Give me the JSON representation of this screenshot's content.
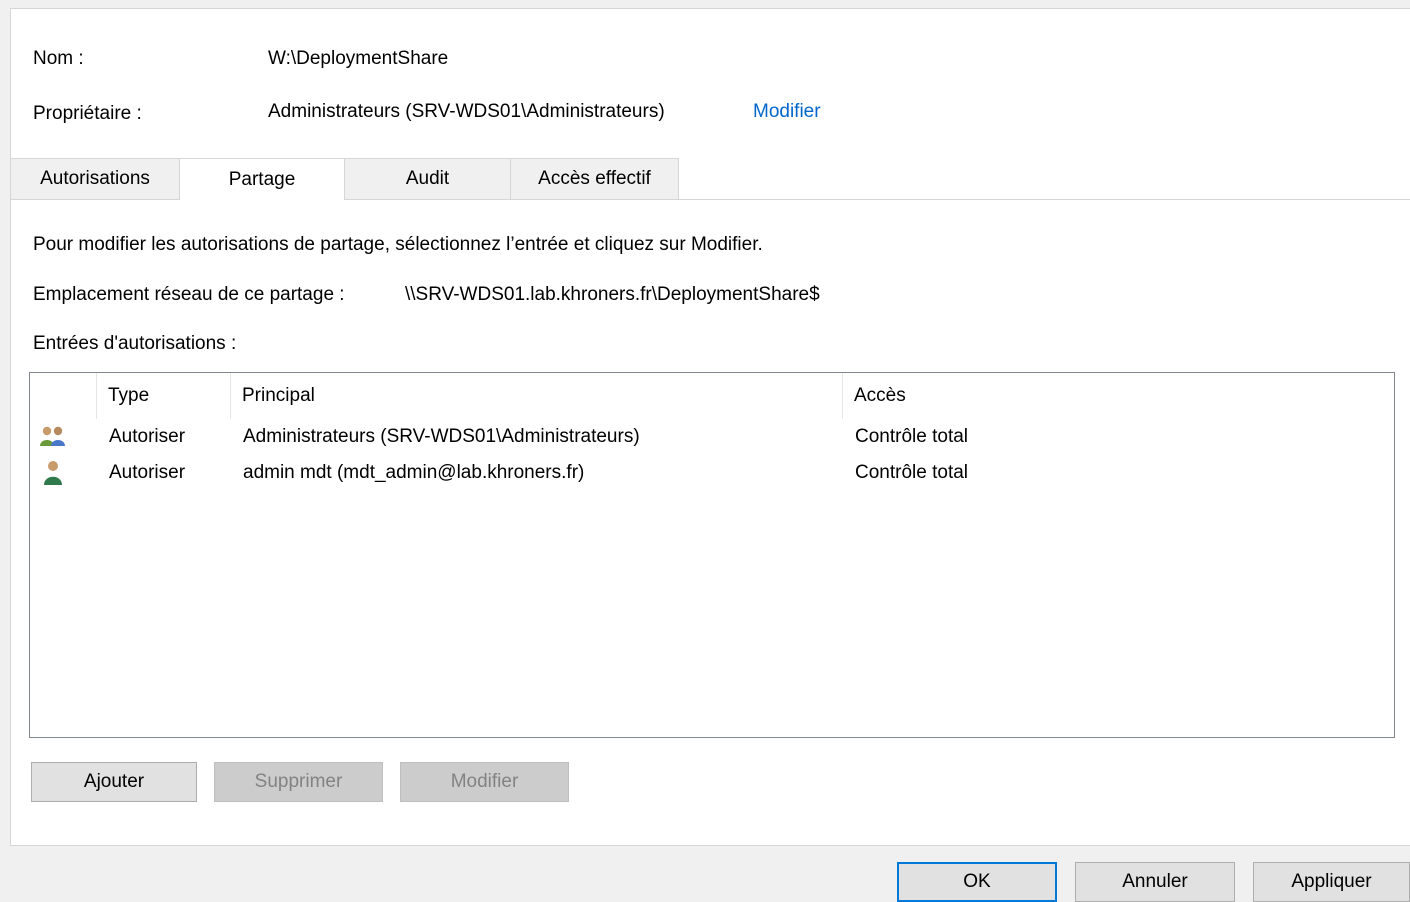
{
  "header": {
    "name_label": "Nom :",
    "name_value": "W:\\DeploymentShare",
    "owner_label": "Propriétaire :",
    "owner_value": "Administrateurs (SRV-WDS01\\Administrateurs)",
    "owner_change_link": "Modifier"
  },
  "tabs": [
    {
      "label": "Autorisations"
    },
    {
      "label": "Partage",
      "active": true
    },
    {
      "label": "Audit"
    },
    {
      "label": "Accès effectif"
    }
  ],
  "sharing": {
    "instructions": "Pour modifier les autorisations de partage, sélectionnez l’entrée et cliquez sur Modifier.",
    "network_location_label": "Emplacement réseau de ce partage :",
    "network_location_value": "\\\\SRV-WDS01.lab.khroners.fr\\DeploymentShare$",
    "entries_label": "Entrées d'autorisations :"
  },
  "table": {
    "columns": [
      "Type",
      "Principal",
      "Accès"
    ],
    "rows": [
      {
        "icon": "group-users-icon",
        "type": "Autoriser",
        "principal": "Administrateurs (SRV-WDS01\\Administrateurs)",
        "access": "Contrôle total"
      },
      {
        "icon": "user-icon",
        "type": "Autoriser",
        "principal": "admin mdt (mdt_admin@lab.khroners.fr)",
        "access": "Contrôle total"
      }
    ]
  },
  "entry_buttons": {
    "add": "Ajouter",
    "remove": "Supprimer",
    "edit": "Modifier"
  },
  "dialog_buttons": {
    "ok": "OK",
    "cancel": "Annuler",
    "apply": "Appliquer"
  },
  "colors": {
    "link": "#0066cc",
    "default_button_border": "#0078d7"
  }
}
